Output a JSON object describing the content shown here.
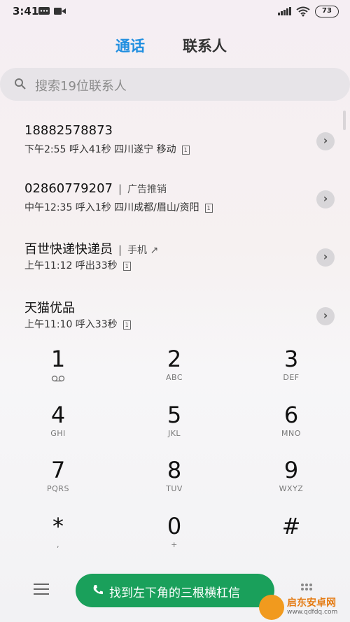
{
  "status_bar": {
    "time": "3:41",
    "battery": "73"
  },
  "tabs": [
    {
      "label": "通话"
    },
    {
      "label": "联系人"
    }
  ],
  "search": {
    "placeholder": "搜索19位联系人"
  },
  "calls": [
    {
      "name": "18882578873",
      "tag": "",
      "detail": "下午2:55 呼入41秒 四川遂宁 移动"
    },
    {
      "name": "02860779207",
      "tag": "广告推销",
      "detail": "中午12:35 呼入1秒 四川成都/眉山/资阳"
    },
    {
      "name": "百世快递快递员",
      "tag": "手机 ↗",
      "detail": "上午11:12 呼出33秒"
    },
    {
      "name": "天猫优品",
      "tag": "",
      "detail": "上午11:10 呼入33秒"
    }
  ],
  "sim_label": "1",
  "keypad": [
    {
      "digit": "1",
      "letters": ""
    },
    {
      "digit": "2",
      "letters": "ABC"
    },
    {
      "digit": "3",
      "letters": "DEF"
    },
    {
      "digit": "4",
      "letters": "GHI"
    },
    {
      "digit": "5",
      "letters": "JKL"
    },
    {
      "digit": "6",
      "letters": "MNO"
    },
    {
      "digit": "7",
      "letters": "PQRS"
    },
    {
      "digit": "8",
      "letters": "TUV"
    },
    {
      "digit": "9",
      "letters": "WXYZ"
    },
    {
      "digit": "*",
      "letters": ","
    },
    {
      "digit": "0",
      "letters": "+"
    },
    {
      "digit": "#",
      "letters": ""
    }
  ],
  "call_button": {
    "label": "找到左下角的三根横杠信"
  },
  "watermark": {
    "text": "启东安卓网",
    "url": "www.qdfdq.com"
  },
  "colors": {
    "accent": "#1f8ee0",
    "call_green": "#1aa05b"
  }
}
